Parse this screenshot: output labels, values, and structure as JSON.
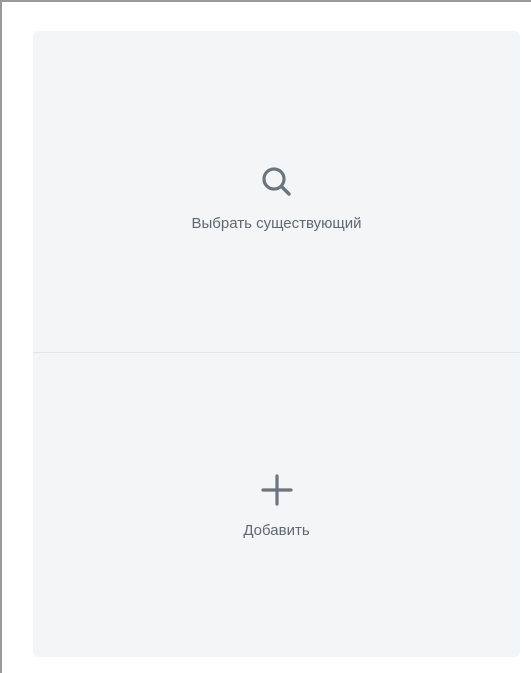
{
  "options": {
    "select_existing": {
      "label": "Выбрать существующий",
      "icon": "search-icon"
    },
    "add": {
      "label": "Добавить",
      "icon": "plus-icon"
    }
  },
  "colors": {
    "panel_background": "#f3f5f7",
    "icon": "#6b7580",
    "label": "#5f6872",
    "divider": "#e2e5e9"
  }
}
